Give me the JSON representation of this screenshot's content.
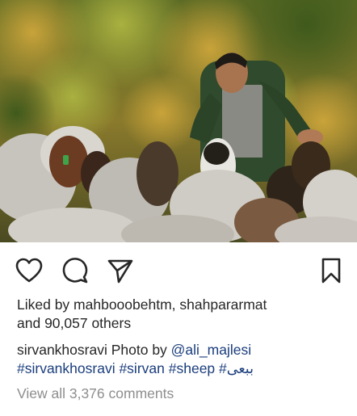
{
  "post": {
    "likes_prefix": "Liked by ",
    "liker_1": "mahbooobehtm",
    "liker_sep": ", ",
    "liker_2": "shahpararmat",
    "likes_and": " and ",
    "likes_count": "90,057 others",
    "caption_user": "sirvankhosravi",
    "caption_text": " Photo by ",
    "caption_mention": "@ali_majlesi",
    "hashtags": [
      "#sirvankhosravi",
      "#sirvan",
      "#sheep",
      "#ببعی"
    ],
    "view_comments": "View all 3,376 comments"
  },
  "icons": {
    "like": "heart-outline-icon",
    "comment": "speech-bubble-icon",
    "share": "paper-plane-icon",
    "save": "bookmark-icon"
  },
  "colors": {
    "text": "#262626",
    "link": "#1a3d7c",
    "muted": "#8e8e8e"
  }
}
